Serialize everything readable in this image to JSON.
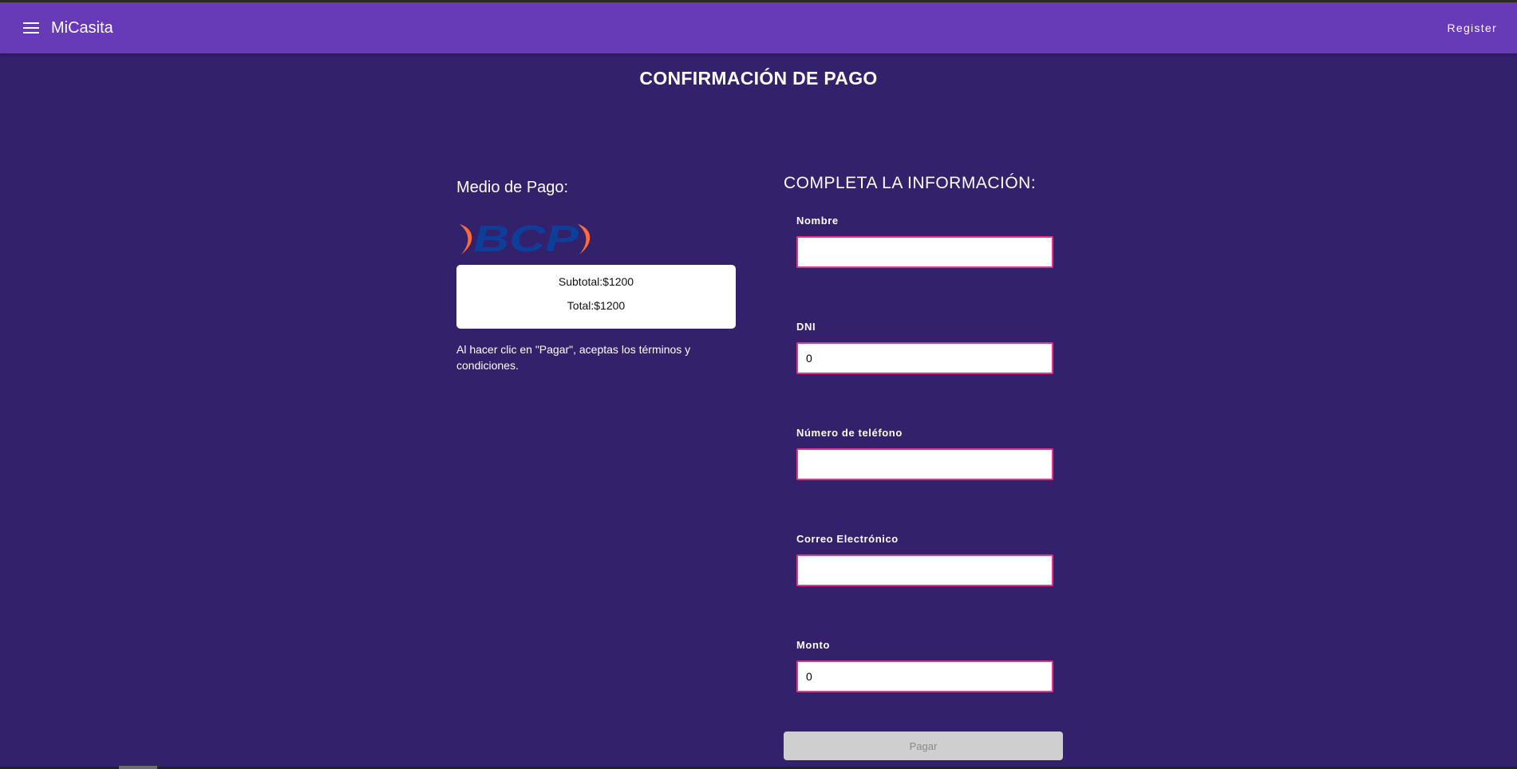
{
  "appbar": {
    "title": "MiCasita",
    "register_label": "Register",
    "menu_icon": "hamburger-menu-icon",
    "color": "#673ab7"
  },
  "page": {
    "title": "CONFIRMACIÓN DE PAGO",
    "background": "#33216b"
  },
  "payment": {
    "heading": "Medio de Pago:",
    "logo_text": "BCP",
    "subtotal": "Subtotal:$1200",
    "total": "Total:$1200",
    "terms": "Al hacer clic en \"Pagar\", aceptas los términos y condiciones."
  },
  "form": {
    "heading": "COMPLETA LA INFORMACIÓN:",
    "fields": [
      {
        "label": "Nombre",
        "value": ""
      },
      {
        "label": "DNI",
        "value": "0"
      },
      {
        "label": "Número de teléfono",
        "value": ""
      },
      {
        "label": "Correo Electrónico",
        "value": ""
      },
      {
        "label": "Monto",
        "value": "0"
      }
    ],
    "submit_label": "Pagar",
    "input_border_color": "#e8338a"
  }
}
